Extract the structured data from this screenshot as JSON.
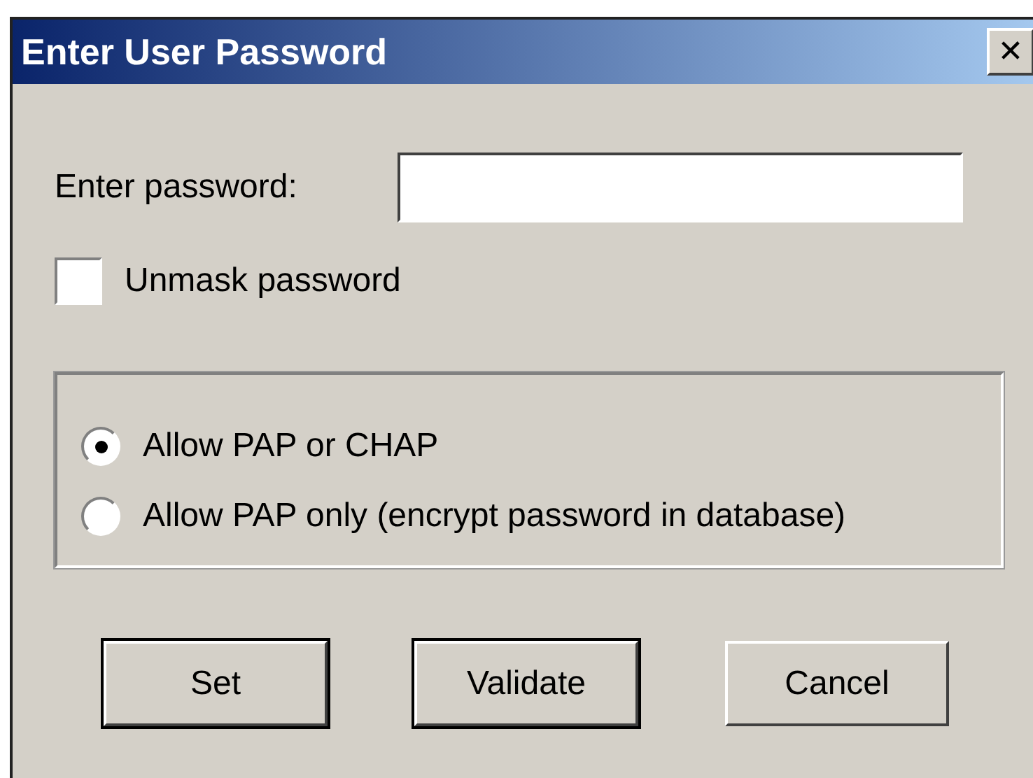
{
  "window": {
    "title": "Enter User Password",
    "close": "✕"
  },
  "password": {
    "label": "Enter password:"
  },
  "unmask": {
    "label": "Unmask password",
    "checked": false
  },
  "options": [
    {
      "label": "Allow PAP or CHAP",
      "selected": true
    },
    {
      "label": "Allow PAP only (encrypt password in database)",
      "selected": false
    }
  ],
  "buttons": [
    {
      "label": "Set",
      "default": true
    },
    {
      "label": "Validate",
      "default": true
    },
    {
      "label": "Cancel",
      "default": false
    }
  ]
}
